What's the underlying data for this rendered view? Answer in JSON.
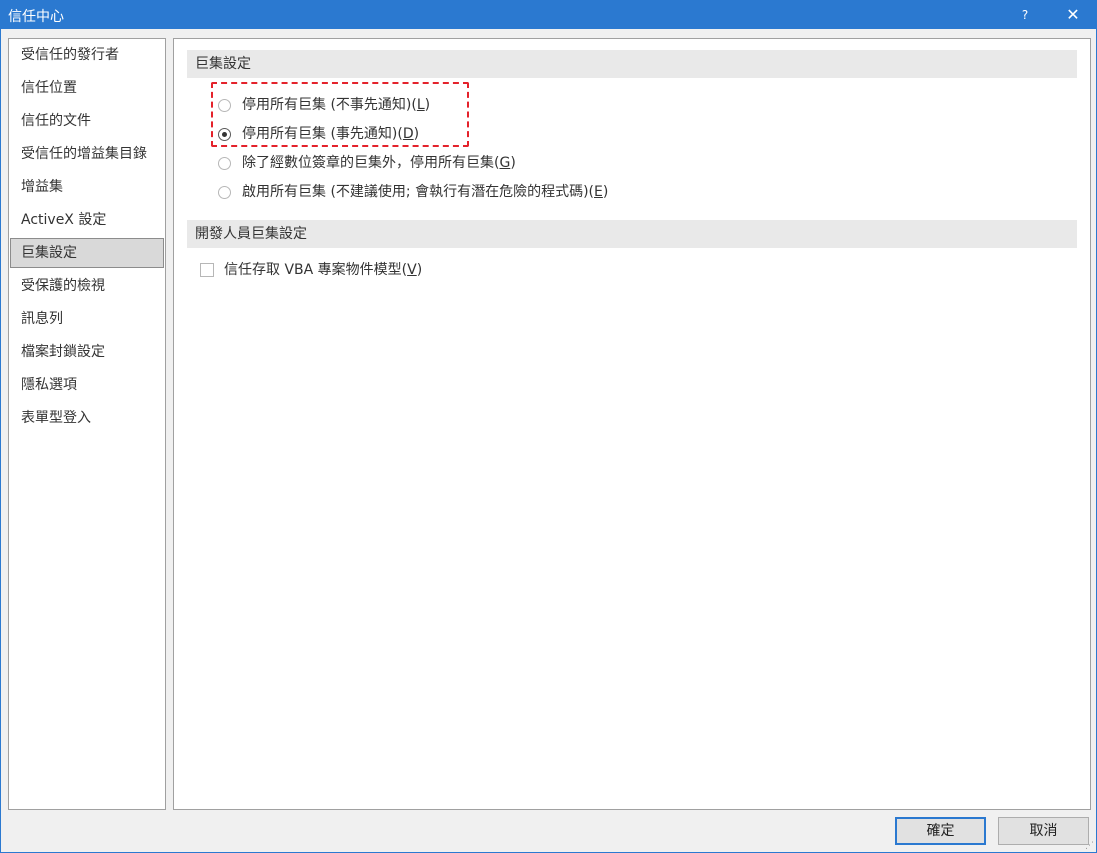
{
  "window": {
    "title": "信任中心",
    "help_label": "?",
    "close_label": "✕"
  },
  "sidebar": {
    "items": [
      {
        "label": "受信任的發行者"
      },
      {
        "label": "信任位置"
      },
      {
        "label": "信任的文件"
      },
      {
        "label": "受信任的增益集目錄"
      },
      {
        "label": "增益集"
      },
      {
        "label": "ActiveX 設定"
      },
      {
        "label": "巨集設定",
        "selected": true
      },
      {
        "label": "受保護的檢視"
      },
      {
        "label": "訊息列"
      },
      {
        "label": "檔案封鎖設定"
      },
      {
        "label": "隱私選項"
      },
      {
        "label": "表單型登入"
      }
    ]
  },
  "macro_settings": {
    "header": "巨集設定",
    "options": [
      {
        "text": "停用所有巨集 (不事先通知)(",
        "key": "L",
        "tail": ")",
        "checked": false
      },
      {
        "text": "停用所有巨集 (事先通知)(",
        "key": "D",
        "tail": ")",
        "checked": true
      },
      {
        "text": "除了經數位簽章的巨集外，停用所有巨集(",
        "key": "G",
        "tail": ")",
        "checked": false
      },
      {
        "text": "啟用所有巨集 (不建議使用; 會執行有潛在危險的程式碼)(",
        "key": "E",
        "tail": ")",
        "checked": false
      }
    ]
  },
  "developer_settings": {
    "header": "開發人員巨集設定",
    "vba_checkbox": {
      "text": "信任存取 VBA 專案物件模型(",
      "key": "V",
      "tail": ")",
      "checked": false
    }
  },
  "buttons": {
    "ok_label": "確定",
    "cancel_label": "取消"
  },
  "colors": {
    "titlebar": "#2b79d0",
    "highlight": "#e4222b"
  }
}
